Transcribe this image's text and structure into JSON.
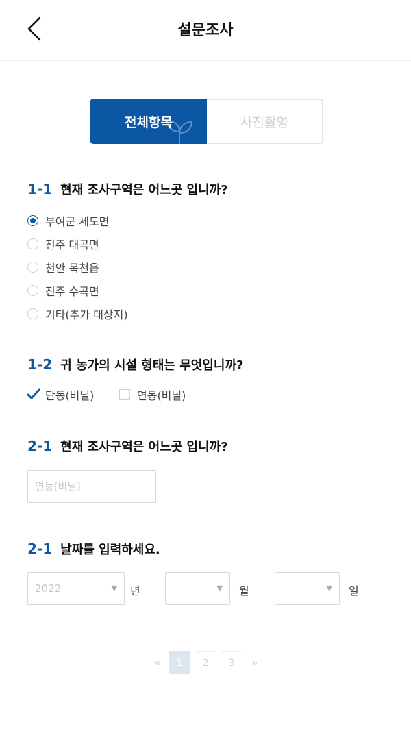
{
  "header": {
    "title": "설문조사",
    "back_icon": "chevron-left-icon"
  },
  "tabs": [
    {
      "label": "전체항목",
      "active": true
    },
    {
      "label": "사진촬영",
      "active": false
    }
  ],
  "questions": {
    "q1": {
      "number": "1-1",
      "text": "현재 조사구역은 어느곳 입니까?",
      "options": [
        {
          "label": "부여군 세도면",
          "selected": true
        },
        {
          "label": "진주 대곡면",
          "selected": false
        },
        {
          "label": "천안 목천읍",
          "selected": false
        },
        {
          "label": "진주 수곡면",
          "selected": false
        },
        {
          "label": "기타(추가 대상지)",
          "selected": false
        }
      ]
    },
    "q2": {
      "number": "1-2",
      "text": "귀 농가의 시설 형태는 무엇입니까?",
      "options": [
        {
          "label": "단동(비닐)",
          "checked": true
        },
        {
          "label": "연동(비닐)",
          "checked": false
        }
      ]
    },
    "q3": {
      "number": "2-1",
      "text": "현재 조사구역은 어느곳 입니까?",
      "input_placeholder": "연동(비닐)"
    },
    "q4": {
      "number": "2-1",
      "text": "날짜를 입력하세요.",
      "year_value": "2022",
      "year_unit": "년",
      "month_value": "",
      "month_unit": "월",
      "day_value": "",
      "day_unit": "일"
    }
  },
  "pagination": {
    "prev": "«",
    "pages": [
      "1",
      "2",
      "3"
    ],
    "current": "1",
    "next": "»"
  },
  "colors": {
    "accent": "#0b57a4",
    "border": "#d9d9d9",
    "muted": "#c8c8c8"
  }
}
